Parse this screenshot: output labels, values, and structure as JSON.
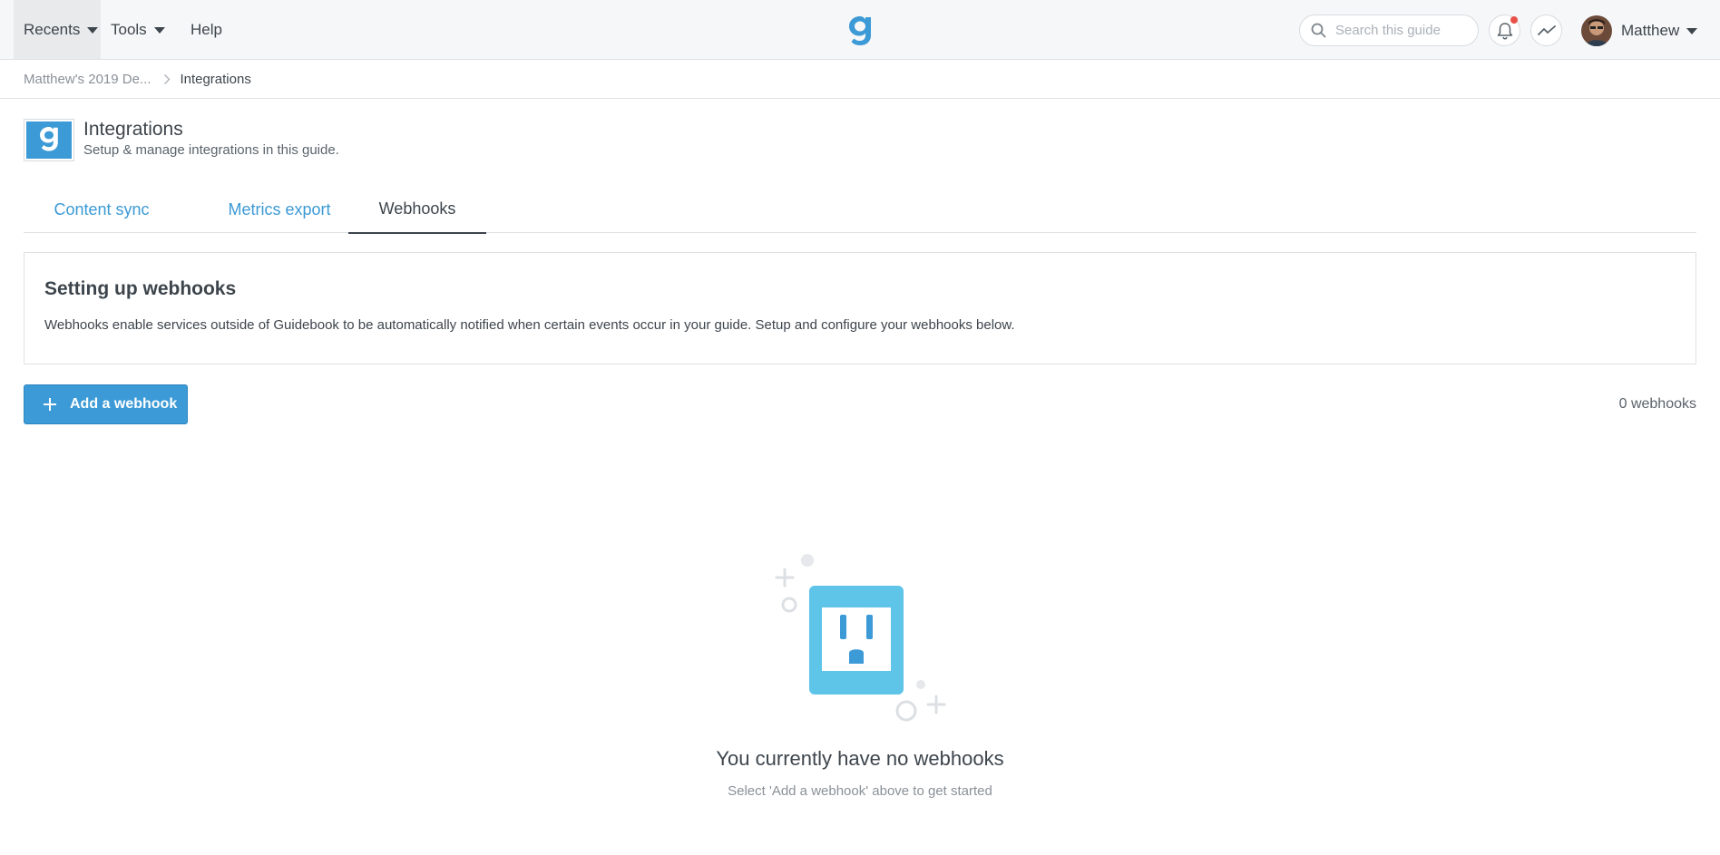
{
  "nav": {
    "recents_label": "Recents",
    "tools_label": "Tools",
    "help_label": "Help",
    "search_placeholder": "Search this guide",
    "user_name": "Matthew"
  },
  "breadcrumb": {
    "parent": "Matthew's 2019 De...",
    "current": "Integrations"
  },
  "page": {
    "title": "Integrations",
    "subtitle": "Setup & manage integrations in this guide."
  },
  "tabs": [
    {
      "label": "Content sync",
      "active": false
    },
    {
      "label": "Metrics export",
      "active": false
    },
    {
      "label": "Webhooks",
      "active": true
    }
  ],
  "info_card": {
    "title": "Setting up webhooks",
    "text": "Webhooks enable services outside of Guidebook to be automatically notified when certain events occur in your guide. Setup and configure your webhooks below."
  },
  "actions": {
    "add_label": "Add a webhook",
    "count_label": "0 webhooks"
  },
  "empty_state": {
    "title": "You currently have no webhooks",
    "subtitle": "Select 'Add a webhook' above to get started"
  },
  "colors": {
    "accent": "#3c9ad6",
    "outlet": "#5ec4e8",
    "notification": "#e8514a"
  },
  "icons": [
    "chevron-down-icon",
    "search-icon",
    "bell-icon",
    "activity-icon",
    "plus-icon",
    "outlet-icon"
  ]
}
